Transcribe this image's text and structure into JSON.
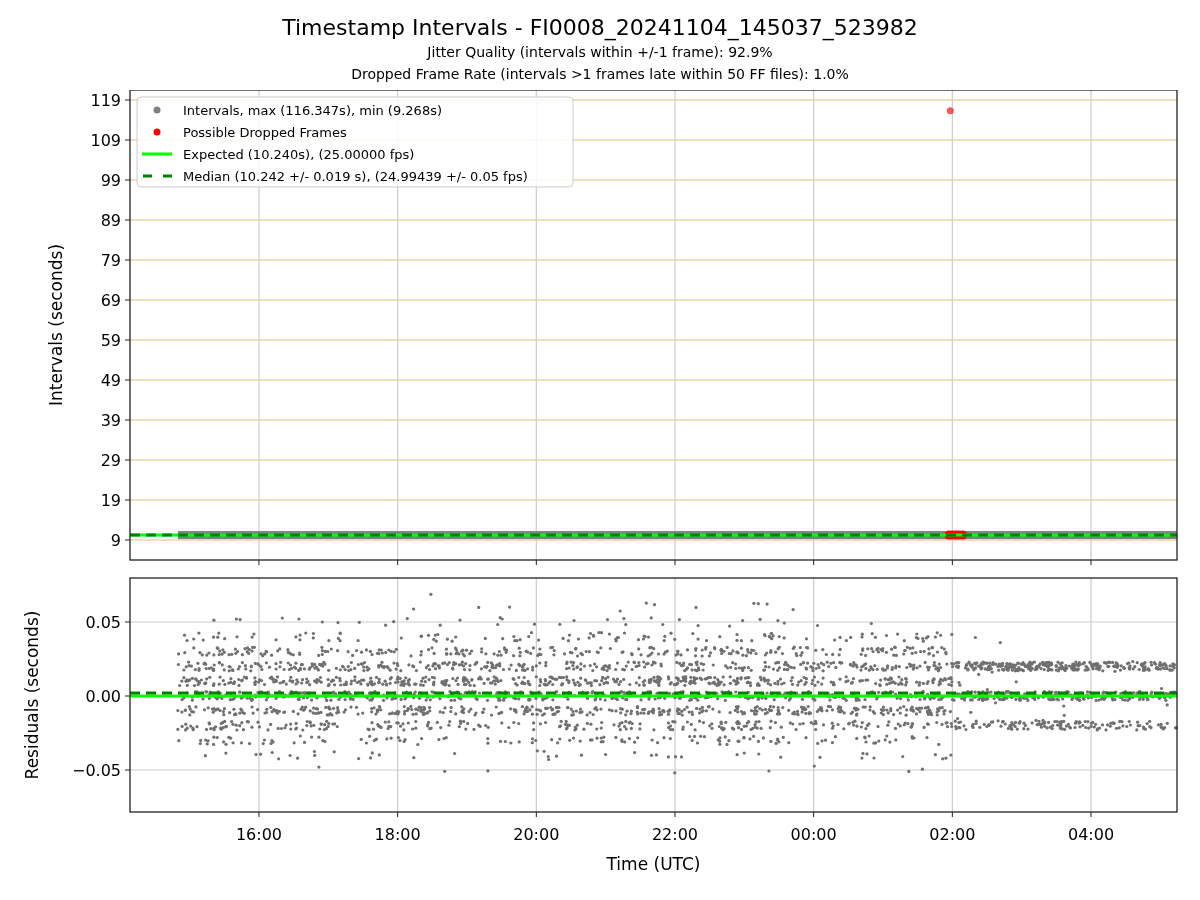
{
  "figure": {
    "title": "Timestamp Intervals - FI0008_20241104_145037_523982",
    "subtitles": [
      "Jitter Quality (intervals within +/-1 frame): 92.9%",
      "Dropped Frame Rate (intervals >1 frames late within 50 FF files): 1.0%"
    ]
  },
  "intervals_plot": {
    "ylabel": "Intervals (seconds)",
    "y_tick_labels": [
      "119",
      "109",
      "99",
      "89",
      "79",
      "69",
      "59",
      "49",
      "39",
      "29",
      "19",
      "9"
    ],
    "legend": [
      {
        "kind": "dot",
        "color": "#808080",
        "label": "Intervals, max (116.347s), min (9.268s)"
      },
      {
        "kind": "dot",
        "color": "#ff0000",
        "label": "Possible Dropped Frames"
      },
      {
        "kind": "line",
        "color": "#00ff00",
        "label": "Expected (10.240s), (25.00000 fps)"
      },
      {
        "kind": "dashed",
        "color": "#008000",
        "label": "Median (10.242 +/- 0.019 s), (24.99439 +/- 0.05 fps)"
      }
    ]
  },
  "residuals_plot": {
    "ylabel": "Residuals (seconds)",
    "y_tick_labels": [
      "0.05",
      "0.00",
      "−0.05"
    ],
    "x_tick_labels": [
      "16:00",
      "18:00",
      "20:00",
      "22:00",
      "00:00",
      "02:00",
      "04:00"
    ],
    "xlabel": "Time (UTC)"
  }
}
